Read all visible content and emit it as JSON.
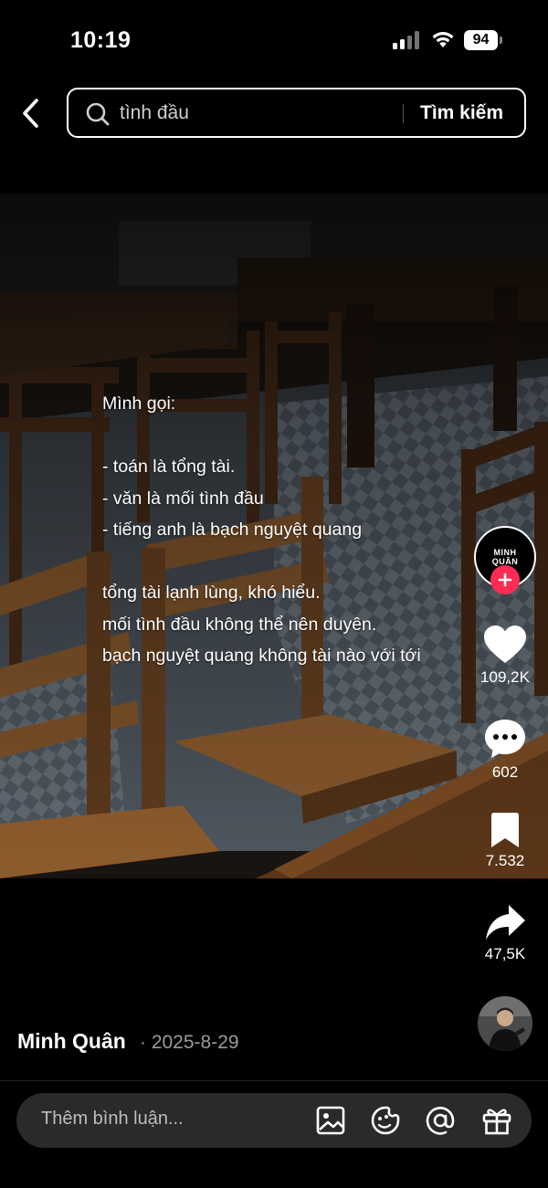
{
  "status_bar": {
    "time": "10:19",
    "battery": "94"
  },
  "search": {
    "query": "tình đầu",
    "submit_label": "Tìm kiếm"
  },
  "video": {
    "caption_lines": [
      "Mình gọi:",
      "",
      "- toán là tổng tài.",
      "- văn là mối tình đầu",
      "- tiếng anh là bạch nguyệt quang",
      "",
      "tổng tài lạnh lùng, khó hiểu.",
      "mối tình đầu không thể nên duyên.",
      "bạch nguyệt quang không tài nào với tới"
    ]
  },
  "rail": {
    "avatar_logo": [
      "MINH",
      "QUÂN"
    ],
    "likes": "109,2K",
    "comments": "602",
    "saves": "7.532",
    "shares": "47,5K"
  },
  "author": {
    "name": "Minh Quân",
    "date": "· 2025-8-29"
  },
  "comment_bar": {
    "placeholder": "Thêm bình luận..."
  },
  "colors": {
    "background": "#000000",
    "follow": "#fe2c55",
    "comment_bar": "#2a2a2a"
  },
  "icons": [
    "signal-icon",
    "wifi-icon",
    "battery-icon",
    "back-icon",
    "search-icon",
    "plus-icon",
    "heart-icon",
    "comment-icon",
    "bookmark-icon",
    "share-icon",
    "image-icon",
    "emoji-icon",
    "mention-icon",
    "gift-icon"
  ]
}
